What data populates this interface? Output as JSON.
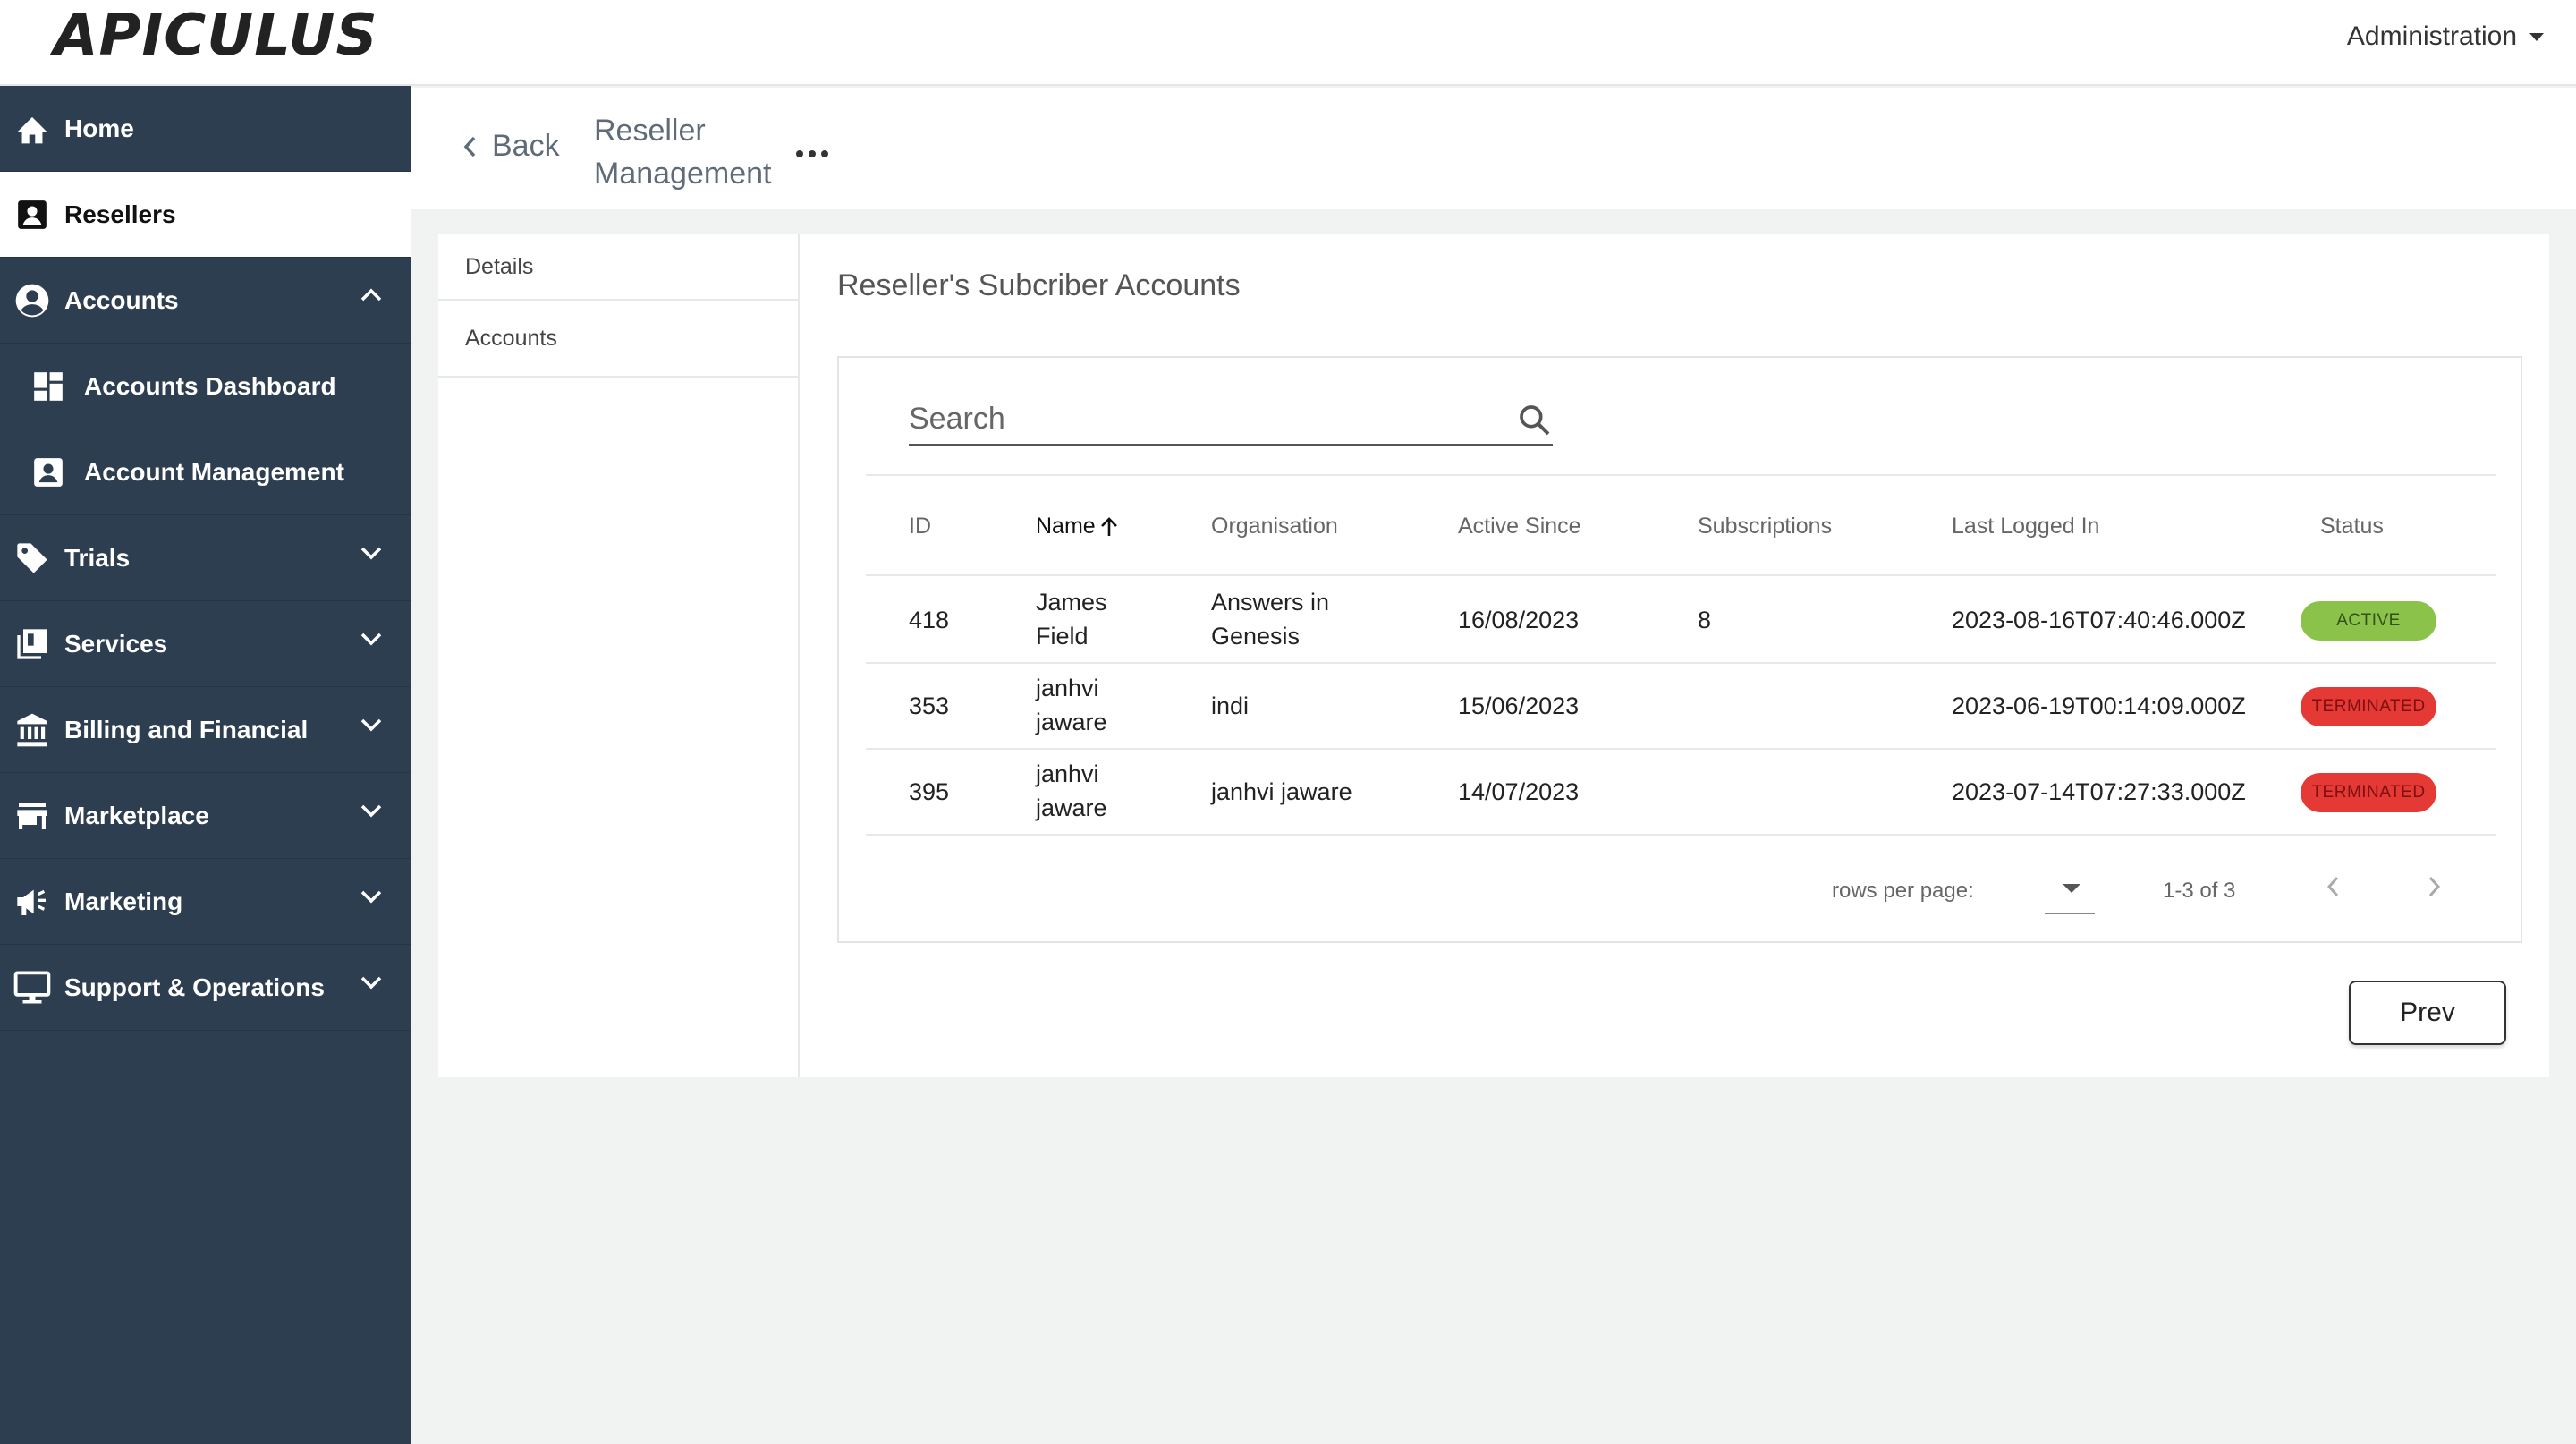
{
  "topbar": {
    "logo_text": "APICULUS",
    "admin_menu_label": "Administration"
  },
  "sidebar": {
    "items": [
      {
        "label": "Home",
        "icon": "home-icon"
      },
      {
        "label": "Resellers",
        "icon": "contact-card-icon",
        "active": true
      },
      {
        "label": "Accounts",
        "icon": "account-circle-icon",
        "expanded": true
      },
      {
        "label": "Accounts Dashboard",
        "icon": "dashboard-icon",
        "sub": true
      },
      {
        "label": "Account Management",
        "icon": "account-box-icon",
        "sub": true
      },
      {
        "label": "Trials",
        "icon": "tag-icon"
      },
      {
        "label": "Services",
        "icon": "library-icon"
      },
      {
        "label": "Billing and Financial",
        "icon": "bank-icon"
      },
      {
        "label": "Marketplace",
        "icon": "store-icon"
      },
      {
        "label": "Marketing",
        "icon": "megaphone-icon"
      },
      {
        "label": "Support & Operations",
        "icon": "monitor-icon"
      }
    ]
  },
  "header": {
    "back_label": "Back",
    "title_line1": "Reseller",
    "title_line2": "Management"
  },
  "tabs": {
    "details": "Details",
    "accounts": "Accounts"
  },
  "section": {
    "title": "Reseller's Subcriber Accounts"
  },
  "search": {
    "placeholder": "Search"
  },
  "table": {
    "columns": {
      "id": "ID",
      "name": "Name",
      "organisation": "Organisation",
      "active_since": "Active Since",
      "subscriptions": "Subscriptions",
      "last_logged_in": "Last Logged In",
      "status": "Status"
    },
    "rows": [
      {
        "id": "418",
        "name1": "James",
        "name2": "Field",
        "org1": "Answers in",
        "org2": "Genesis",
        "active_since": "16/08/2023",
        "subscriptions": "8",
        "last_logged_in": "2023-08-16T07:40:46.000Z",
        "status": "ACTIVE"
      },
      {
        "id": "353",
        "name1": "janhvi",
        "name2": "jaware",
        "org1": "indi",
        "org2": "",
        "active_since": "15/06/2023",
        "subscriptions": "",
        "last_logged_in": "2023-06-19T00:14:09.000Z",
        "status": "TERMINATED"
      },
      {
        "id": "395",
        "name1": "janhvi",
        "name2": "jaware",
        "org1": "janhvi jaware",
        "org2": "",
        "active_since": "14/07/2023",
        "subscriptions": "",
        "last_logged_in": "2023-07-14T07:27:33.000Z",
        "status": "TERMINATED"
      }
    ]
  },
  "pager": {
    "rows_per_page_label": "rows per page:",
    "range_text": "1-3 of 3"
  },
  "footer": {
    "prev_label": "Prev"
  },
  "colors": {
    "sidebar_bg": "#2e3e51",
    "active_badge": "#8bc34a",
    "terminated_badge": "#e53935"
  }
}
